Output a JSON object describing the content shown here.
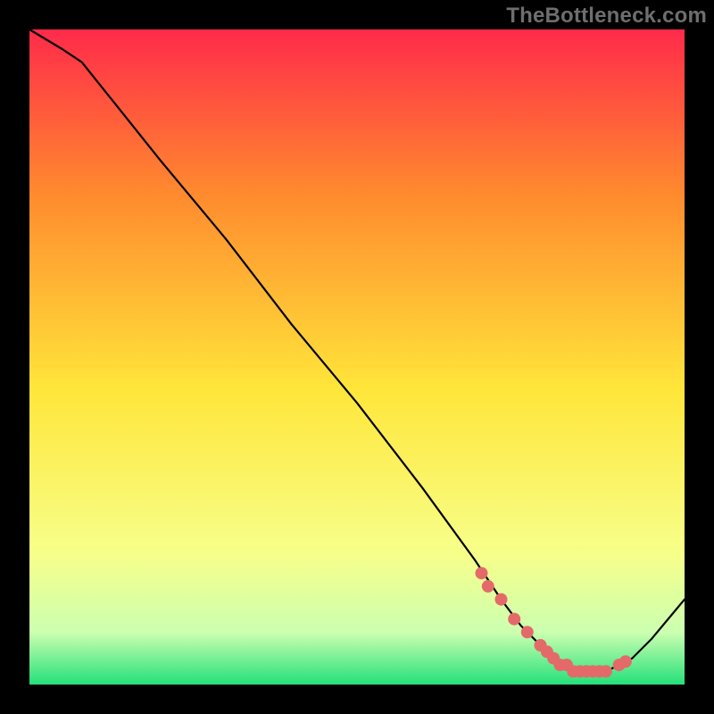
{
  "watermark": "TheBottleneck.com",
  "colors": {
    "frame": "#000000",
    "gradient_top": "#ff2a4a",
    "gradient_mid_upper": "#ff8a2e",
    "gradient_mid": "#ffe63a",
    "gradient_mid_lower": "#f7ff8a",
    "gradient_low": "#ccffb0",
    "gradient_bottom": "#25e07a",
    "curve_stroke": "#000000",
    "marker_fill": "#e46a6a",
    "marker_stroke": "#c85050"
  },
  "chart_data": {
    "type": "line",
    "title": "",
    "xlabel": "",
    "ylabel": "",
    "xlim": [
      0,
      100
    ],
    "ylim": [
      0,
      100
    ],
    "grid": false,
    "series": [
      {
        "name": "bottleneck-curve",
        "x": [
          0,
          5,
          8,
          12,
          20,
          30,
          40,
          50,
          60,
          68,
          72,
          75,
          78,
          80,
          82,
          84,
          86,
          88,
          90,
          92,
          95,
          100
        ],
        "y": [
          100,
          97,
          95,
          90,
          80,
          68,
          55,
          43,
          30,
          19,
          13,
          9,
          6,
          4,
          3,
          2,
          2,
          2,
          3,
          4,
          7,
          13
        ]
      }
    ],
    "markers": {
      "name": "highlight-points",
      "x": [
        69,
        70,
        72,
        74,
        76,
        78,
        79,
        80,
        81,
        82,
        83,
        84,
        85,
        86,
        87,
        88,
        90,
        91
      ],
      "y": [
        17,
        15,
        13,
        10,
        8,
        6,
        5,
        4,
        3,
        3,
        2,
        2,
        2,
        2,
        2,
        2,
        3,
        3.5
      ]
    }
  }
}
